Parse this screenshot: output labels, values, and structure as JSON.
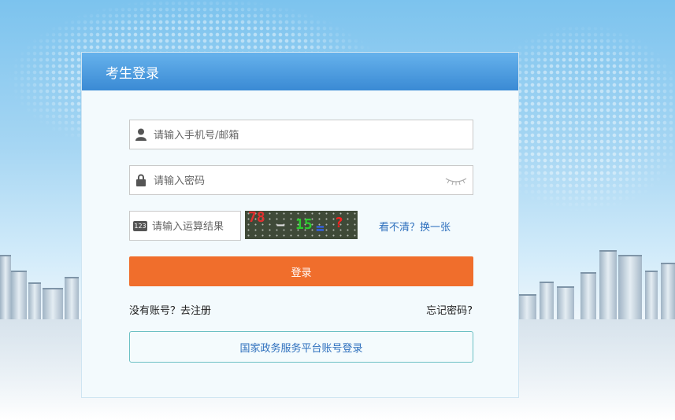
{
  "panel": {
    "title": "考生登录"
  },
  "form": {
    "username_placeholder": "请输入手机号/邮箱",
    "password_placeholder": "请输入密码",
    "captcha_placeholder": "请输入运算结果",
    "captcha_icon_label": "123",
    "captcha_text": {
      "a": "78",
      "op": "−",
      "b": "15",
      "eq": "=",
      "q": "?"
    },
    "refresh_captcha_label": "看不清？换一张",
    "login_button": "登录",
    "no_account_text": "没有账号？",
    "register_link": "去注册",
    "forgot_password": "忘记密码?",
    "gov_login_button": "国家政务服务平台账号登录"
  },
  "icons": [
    "user-icon",
    "lock-icon",
    "eye-closed-icon",
    "captcha-123-icon"
  ],
  "colors": {
    "header": "#3a8ad4",
    "login_button": "#f06e2c",
    "link": "#2d6fbd",
    "gov_border": "#6cc0c4"
  }
}
